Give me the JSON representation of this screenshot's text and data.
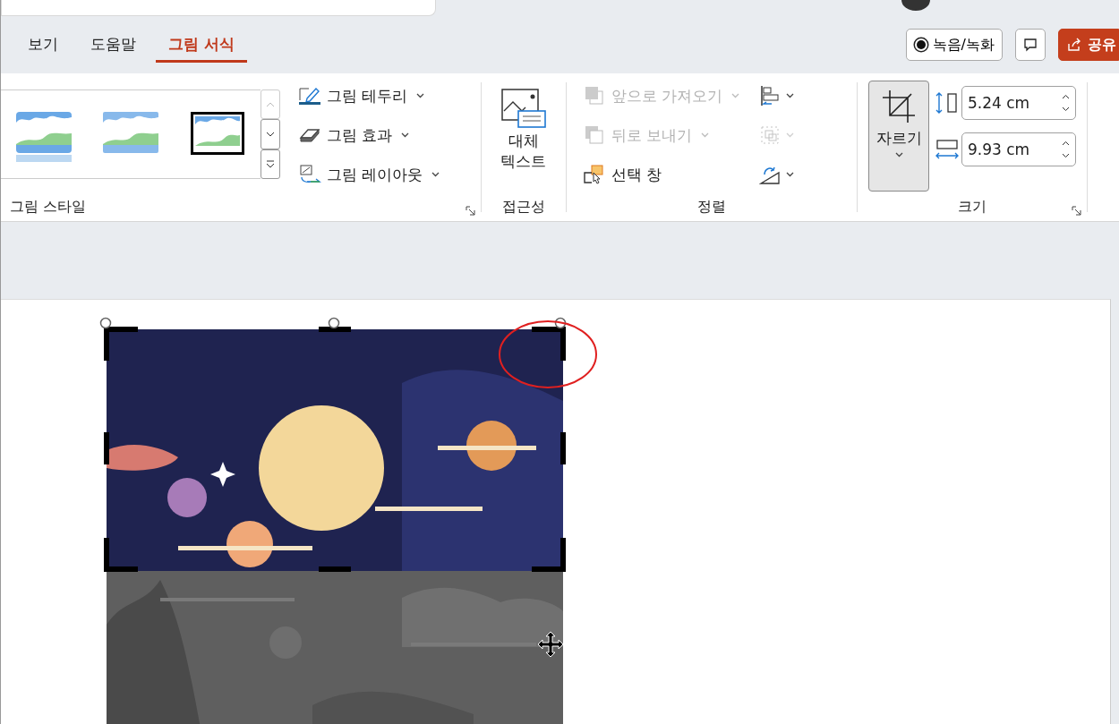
{
  "tabs": [
    {
      "label": "보기",
      "selected": false
    },
    {
      "label": "도움말",
      "selected": false
    },
    {
      "label": "그림 서식",
      "selected": true
    }
  ],
  "header_buttons": [
    {
      "kind": "record",
      "label": "녹음/녹화"
    },
    {
      "kind": "comment"
    },
    {
      "kind": "share",
      "label": "공유"
    }
  ],
  "ribbon": {
    "picture_styles": {
      "label": "그림 스타일",
      "gallery": [
        {
          "kind": "soft"
        },
        {
          "kind": "glow"
        },
        {
          "kind": "frame"
        }
      ],
      "commands": [
        {
          "kind": "border",
          "label": "그림 테두리"
        },
        {
          "kind": "effects",
          "label": "그림 효과"
        },
        {
          "kind": "layout",
          "label": "그림 레이아웃"
        }
      ]
    },
    "accessibility": {
      "label": "접근성",
      "button": "대체 텍스트"
    },
    "arrange": {
      "label": "정렬",
      "commands": [
        {
          "kind": "forward",
          "label": "앞으로 가져오기",
          "disabled": true
        },
        {
          "kind": "backward",
          "label": "뒤로 보내기",
          "disabled": true
        },
        {
          "kind": "pane",
          "label": "선택 창",
          "disabled": false
        }
      ],
      "icons": [
        {
          "kind": "align",
          "disabled": false
        },
        {
          "kind": "group",
          "disabled": true
        },
        {
          "kind": "rotate",
          "disabled": false
        }
      ]
    },
    "size": {
      "label": "크기",
      "crop": {
        "label": "자르기",
        "selected": true
      },
      "fields": [
        {
          "kind": "height",
          "value": "5.24 cm"
        },
        {
          "kind": "width",
          "value": "9.93 cm"
        }
      ]
    }
  }
}
